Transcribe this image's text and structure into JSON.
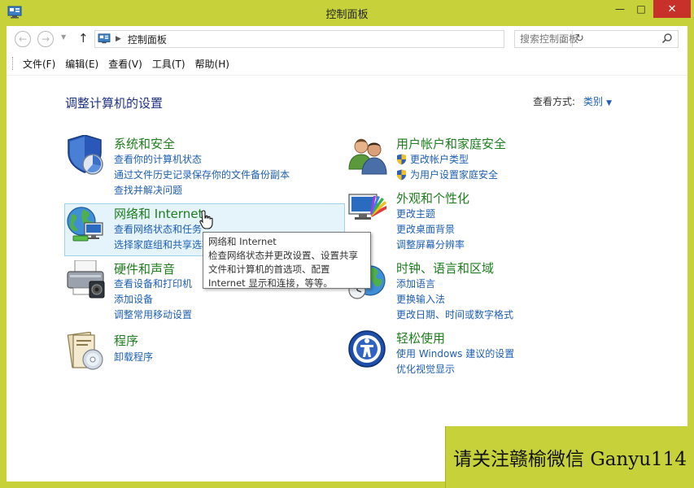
{
  "window": {
    "title": "控制面板",
    "minimize": "—",
    "maximize": "□",
    "close": "✕"
  },
  "nav": {
    "back": "←",
    "forward": "→",
    "recent": "▼",
    "up": "↑",
    "address_sep": "▶",
    "address": "控制面板",
    "address_dropdown": "⌵",
    "refresh": "↻"
  },
  "search": {
    "placeholder": "搜索控制面板"
  },
  "menu": {
    "file": "文件(F)",
    "edit": "编辑(E)",
    "view": "查看(V)",
    "tools": "工具(T)",
    "help": "帮助(H)"
  },
  "heading": "调整计算机的设置",
  "view_by": {
    "label": "查看方式:",
    "value": "类别",
    "caret": "▼"
  },
  "categories": {
    "system": {
      "title": "系统和安全",
      "links": [
        "查看你的计算机状态",
        "通过文件历史记录保存你的文件备份副本",
        "查找并解决问题"
      ]
    },
    "network": {
      "title": "网络和 Internet",
      "links": [
        "查看网络状态和任务",
        "选择家庭组和共享选项"
      ]
    },
    "hardware": {
      "title": "硬件和声音",
      "links": [
        "查看设备和打印机",
        "添加设备",
        "调整常用移动设置"
      ]
    },
    "programs": {
      "title": "程序",
      "links": [
        "卸载程序"
      ]
    },
    "users": {
      "title": "用户帐户和家庭安全",
      "links": [
        "更改帐户类型",
        "为用户设置家庭安全"
      ]
    },
    "appearance": {
      "title": "外观和个性化",
      "links": [
        "更改主题",
        "更改桌面背景",
        "调整屏幕分辨率"
      ]
    },
    "clock": {
      "title": "时钟、语言和区域",
      "links": [
        "添加语言",
        "更换输入法",
        "更改日期、时间或数字格式"
      ]
    },
    "ease": {
      "title": "轻松使用",
      "links": [
        "使用 Windows 建议的设置",
        "优化视觉显示"
      ]
    }
  },
  "tooltip": {
    "lines": [
      "网络和 Internet",
      "检查网络状态并更改设置、设置共享",
      "文件和计算机的首选项、配置",
      "Internet 显示和连接，等等。"
    ]
  },
  "watermark": "请关注赣榆微信 Ganyu114",
  "colors": {
    "frame": "#c7d23a",
    "close_button": "#c7312a",
    "category_title": "#1e7e1e",
    "link": "#1e5fb4",
    "heading": "#1e3287",
    "highlight": "#e5f3fb"
  }
}
